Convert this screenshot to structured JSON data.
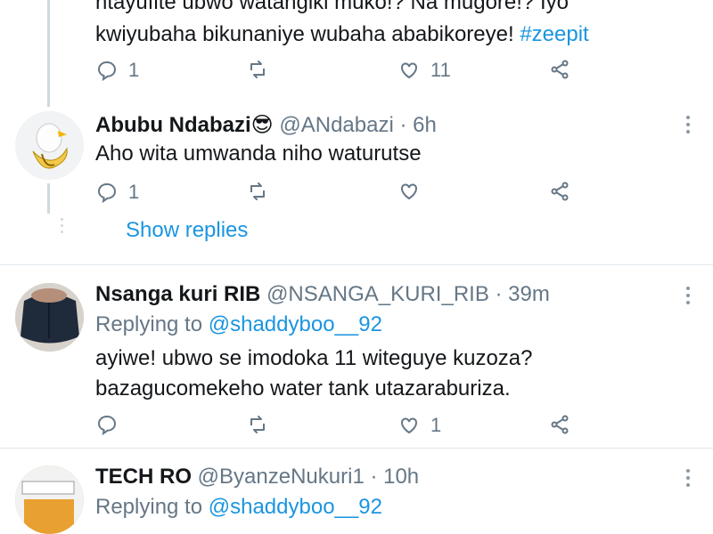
{
  "tweet0": {
    "line1": "ntayufite ubwo watangiki muko!? Na mugore!? Iyo",
    "line2_prefix": "kwiyubaha bikunaniye wubaha ababikoreye! ",
    "line2_hashtag": "#zeepit",
    "reply_count": "1",
    "like_count": "11"
  },
  "tweet1": {
    "name": "Abubu Ndabazi",
    "emoji": "😎",
    "handle": "@ANdabazi · 6h",
    "text": "Aho wita umwanda niho waturutse",
    "reply_count": "1",
    "show_replies": "Show replies"
  },
  "tweet2": {
    "name": "Nsanga kuri RIB",
    "handle": "@NSANGA_KURI_RIB · 39m",
    "replying_label": "Replying to ",
    "replying_mention": "@shaddyboo__92",
    "line1": "ayiwe! ubwo se imodoka 11 witeguye kuzoza?",
    "line2": "bazagucomekeho water tank utazaraburiza.",
    "like_count": "1"
  },
  "tweet3": {
    "name": "TECH RO",
    "handle": "@ByanzeNukuri1 · 10h",
    "replying_label": "Replying to ",
    "replying_mention": "@shaddyboo__92"
  },
  "colors": {
    "link": "#1b95e0",
    "muted": "#657786",
    "divider": "#e1e8ed"
  }
}
